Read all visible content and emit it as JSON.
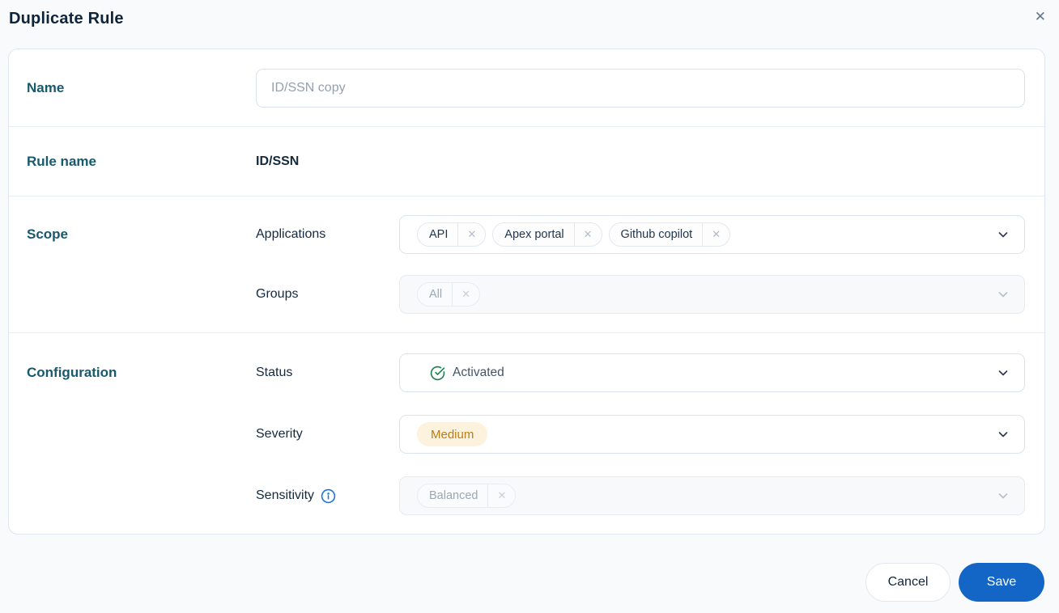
{
  "dialog": {
    "title": "Duplicate Rule"
  },
  "form": {
    "name": {
      "label": "Name",
      "value": "",
      "placeholder": "ID/SSN copy"
    },
    "rule_name": {
      "label": "Rule name",
      "value": "ID/SSN"
    },
    "scope": {
      "label": "Scope",
      "applications": {
        "label": "Applications",
        "chips": [
          "API",
          "Apex portal",
          "Github copilot"
        ],
        "disabled": false
      },
      "groups": {
        "label": "Groups",
        "chips": [
          "All"
        ],
        "disabled": true
      }
    },
    "configuration": {
      "label": "Configuration",
      "status": {
        "label": "Status",
        "value": "Activated",
        "icon": "check-circle-icon",
        "icon_color": "#17804d"
      },
      "severity": {
        "label": "Severity",
        "value": "Medium",
        "badge_bg": "#fdf2de",
        "badge_color": "#b97c15"
      },
      "sensitivity": {
        "label": "Sensitivity",
        "info_icon": "info-icon",
        "info_color": "#1b72d9",
        "chips": [
          "Balanced"
        ],
        "disabled": true
      }
    }
  },
  "footer": {
    "cancel_label": "Cancel",
    "save_label": "Save"
  },
  "colors": {
    "accent_blue": "#1366c5",
    "section_label": "#17596f",
    "card_border": "#dde7f1",
    "page_bg": "#f9fafb"
  }
}
